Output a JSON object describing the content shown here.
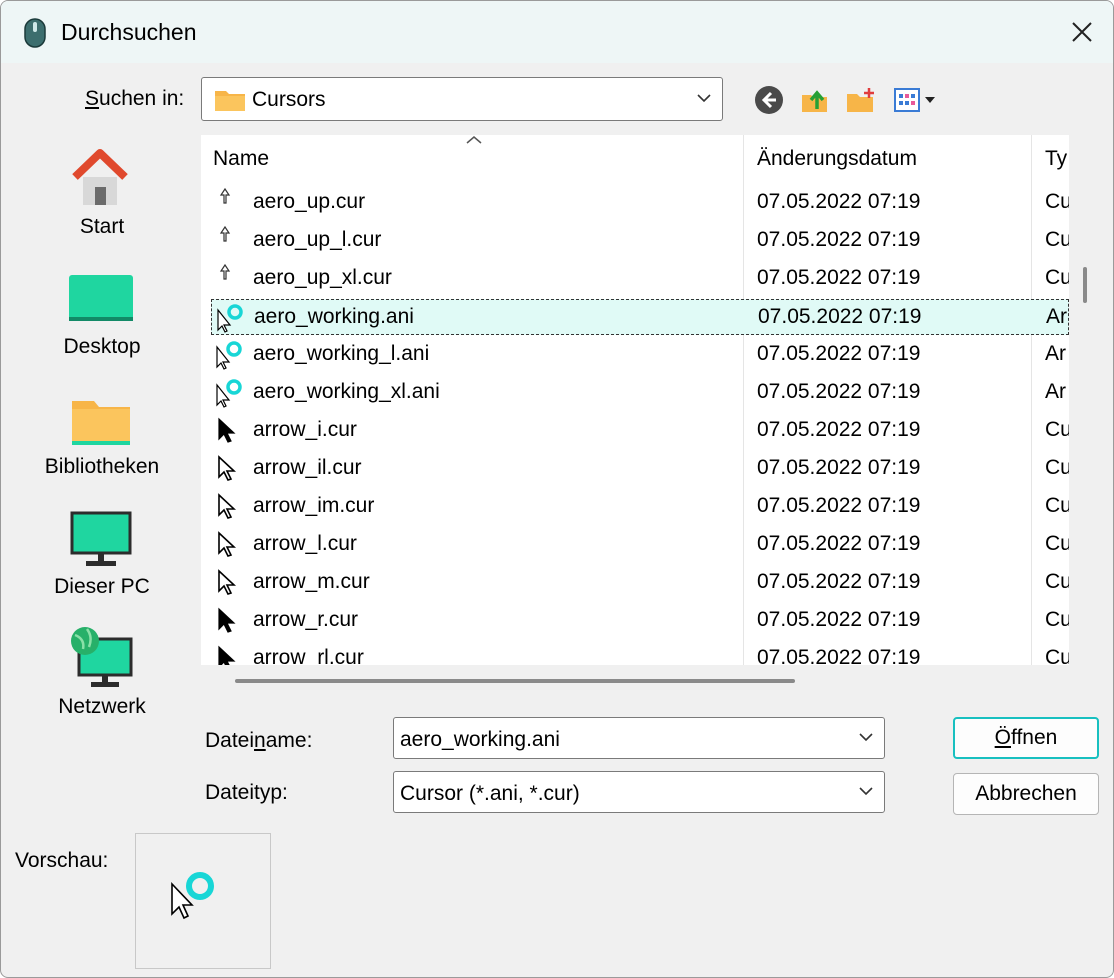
{
  "window": {
    "title": "Durchsuchen"
  },
  "toolbar": {
    "look_in_label_pre": "S",
    "look_in_label_rest": "uchen in:",
    "look_in_value": "Cursors"
  },
  "places": [
    {
      "label": "Start"
    },
    {
      "label": "Desktop"
    },
    {
      "label": "Bibliotheken"
    },
    {
      "label": "Dieser PC"
    },
    {
      "label": "Netzwerk"
    }
  ],
  "columns": {
    "name": "Name",
    "date": "Änderungsdatum",
    "type": "Ty"
  },
  "files": [
    {
      "name": "aero_up.cur",
      "date": "07.05.2022 07:19",
      "type": "Cu",
      "icon": "up-arrow-cursor-icon"
    },
    {
      "name": "aero_up_l.cur",
      "date": "07.05.2022 07:19",
      "type": "Cu",
      "icon": "up-arrow-cursor-icon"
    },
    {
      "name": "aero_up_xl.cur",
      "date": "07.05.2022 07:19",
      "type": "Cu",
      "icon": "up-arrow-cursor-icon"
    },
    {
      "name": "aero_working.ani",
      "date": "07.05.2022 07:19",
      "type": "Ar",
      "icon": "working-cursor-icon",
      "selected": true
    },
    {
      "name": "aero_working_l.ani",
      "date": "07.05.2022 07:19",
      "type": "Ar",
      "icon": "working-cursor-icon"
    },
    {
      "name": "aero_working_xl.ani",
      "date": "07.05.2022 07:19",
      "type": "Ar",
      "icon": "working-cursor-icon"
    },
    {
      "name": "arrow_i.cur",
      "date": "07.05.2022 07:19",
      "type": "Cu",
      "icon": "arrow-cursor-icon"
    },
    {
      "name": "arrow_il.cur",
      "date": "07.05.2022 07:19",
      "type": "Cu",
      "icon": "arrow-cursor-icon"
    },
    {
      "name": "arrow_im.cur",
      "date": "07.05.2022 07:19",
      "type": "Cu",
      "icon": "arrow-cursor-icon"
    },
    {
      "name": "arrow_l.cur",
      "date": "07.05.2022 07:19",
      "type": "Cu",
      "icon": "arrow-cursor-icon"
    },
    {
      "name": "arrow_m.cur",
      "date": "07.05.2022 07:19",
      "type": "Cu",
      "icon": "arrow-cursor-icon"
    },
    {
      "name": "arrow_r.cur",
      "date": "07.05.2022 07:19",
      "type": "Cu",
      "icon": "arrow-cursor-icon"
    },
    {
      "name": "arrow_rl.cur",
      "date": "07.05.2022 07:19",
      "type": "Cu",
      "icon": "arrow-cursor-icon"
    }
  ],
  "filename": {
    "label_pre": "Datei",
    "label_u": "n",
    "label_post": "ame:",
    "value": "aero_working.ani"
  },
  "filetype": {
    "label": "Dateityp:",
    "value": "Cursor (*.ani, *.cur)"
  },
  "buttons": {
    "open_u": "Ö",
    "open_rest": "ffnen",
    "cancel": "Abbrechen"
  },
  "preview": {
    "label": "Vorschau:"
  },
  "colors": {
    "accent": "#18c0c0",
    "selection": "#e0faf6"
  }
}
